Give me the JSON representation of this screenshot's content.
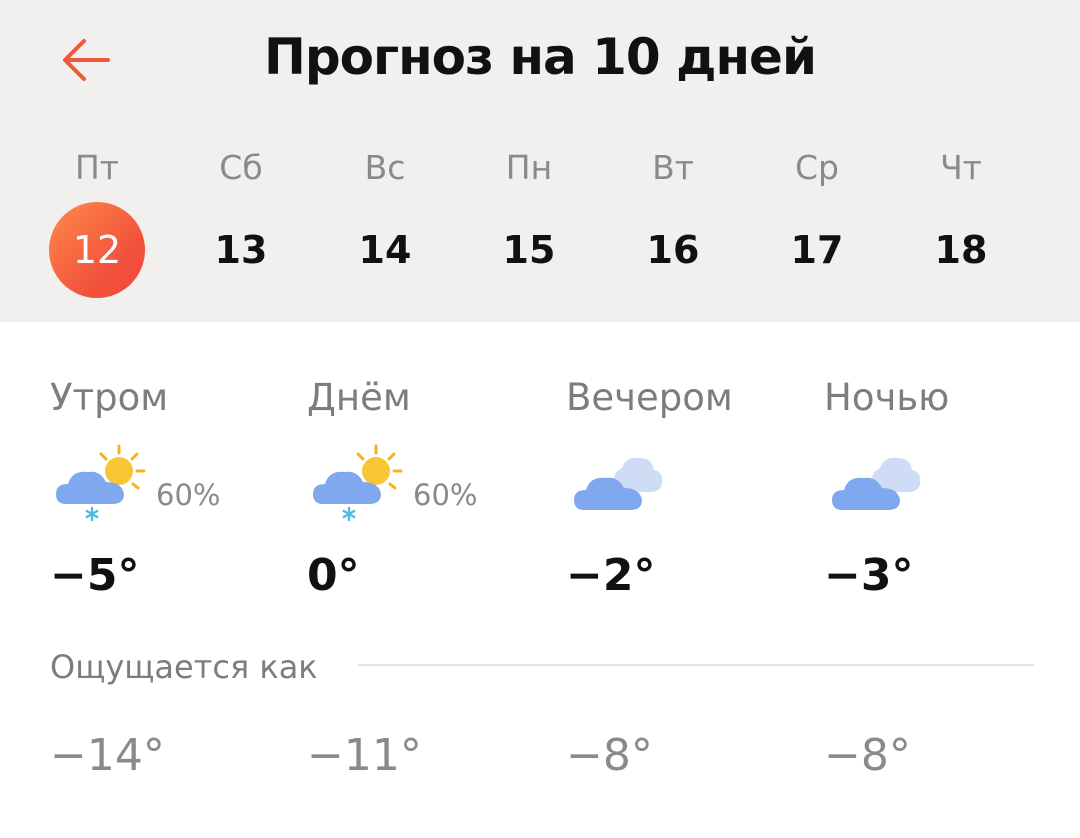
{
  "header": {
    "title": "Прогноз на 10 дней",
    "back_icon": "arrow-left-icon",
    "accent_color": "#f05a3c"
  },
  "days": [
    {
      "dow": "Пт",
      "date": "12",
      "selected": true
    },
    {
      "dow": "Сб",
      "date": "13",
      "selected": false
    },
    {
      "dow": "Вс",
      "date": "14",
      "selected": false
    },
    {
      "dow": "Пн",
      "date": "15",
      "selected": false
    },
    {
      "dow": "Вт",
      "date": "16",
      "selected": false
    },
    {
      "dow": "Ср",
      "date": "17",
      "selected": false
    },
    {
      "dow": "Чт",
      "date": "18",
      "selected": false
    }
  ],
  "periods": [
    {
      "label": "Утром",
      "icon": "partly-cloudy-snow-icon",
      "precip": "60%",
      "temp": "−5°",
      "feels": "−14°"
    },
    {
      "label": "Днём",
      "icon": "partly-cloudy-snow-icon",
      "precip": "60%",
      "temp": "0°",
      "feels": "−11°"
    },
    {
      "label": "Вечером",
      "icon": "cloudy-icon",
      "precip": "",
      "temp": "−2°",
      "feels": "−8°"
    },
    {
      "label": "Ночью",
      "icon": "cloudy-icon",
      "precip": "",
      "temp": "−3°",
      "feels": "−8°"
    }
  ],
  "feels_label": "Ощущается как"
}
